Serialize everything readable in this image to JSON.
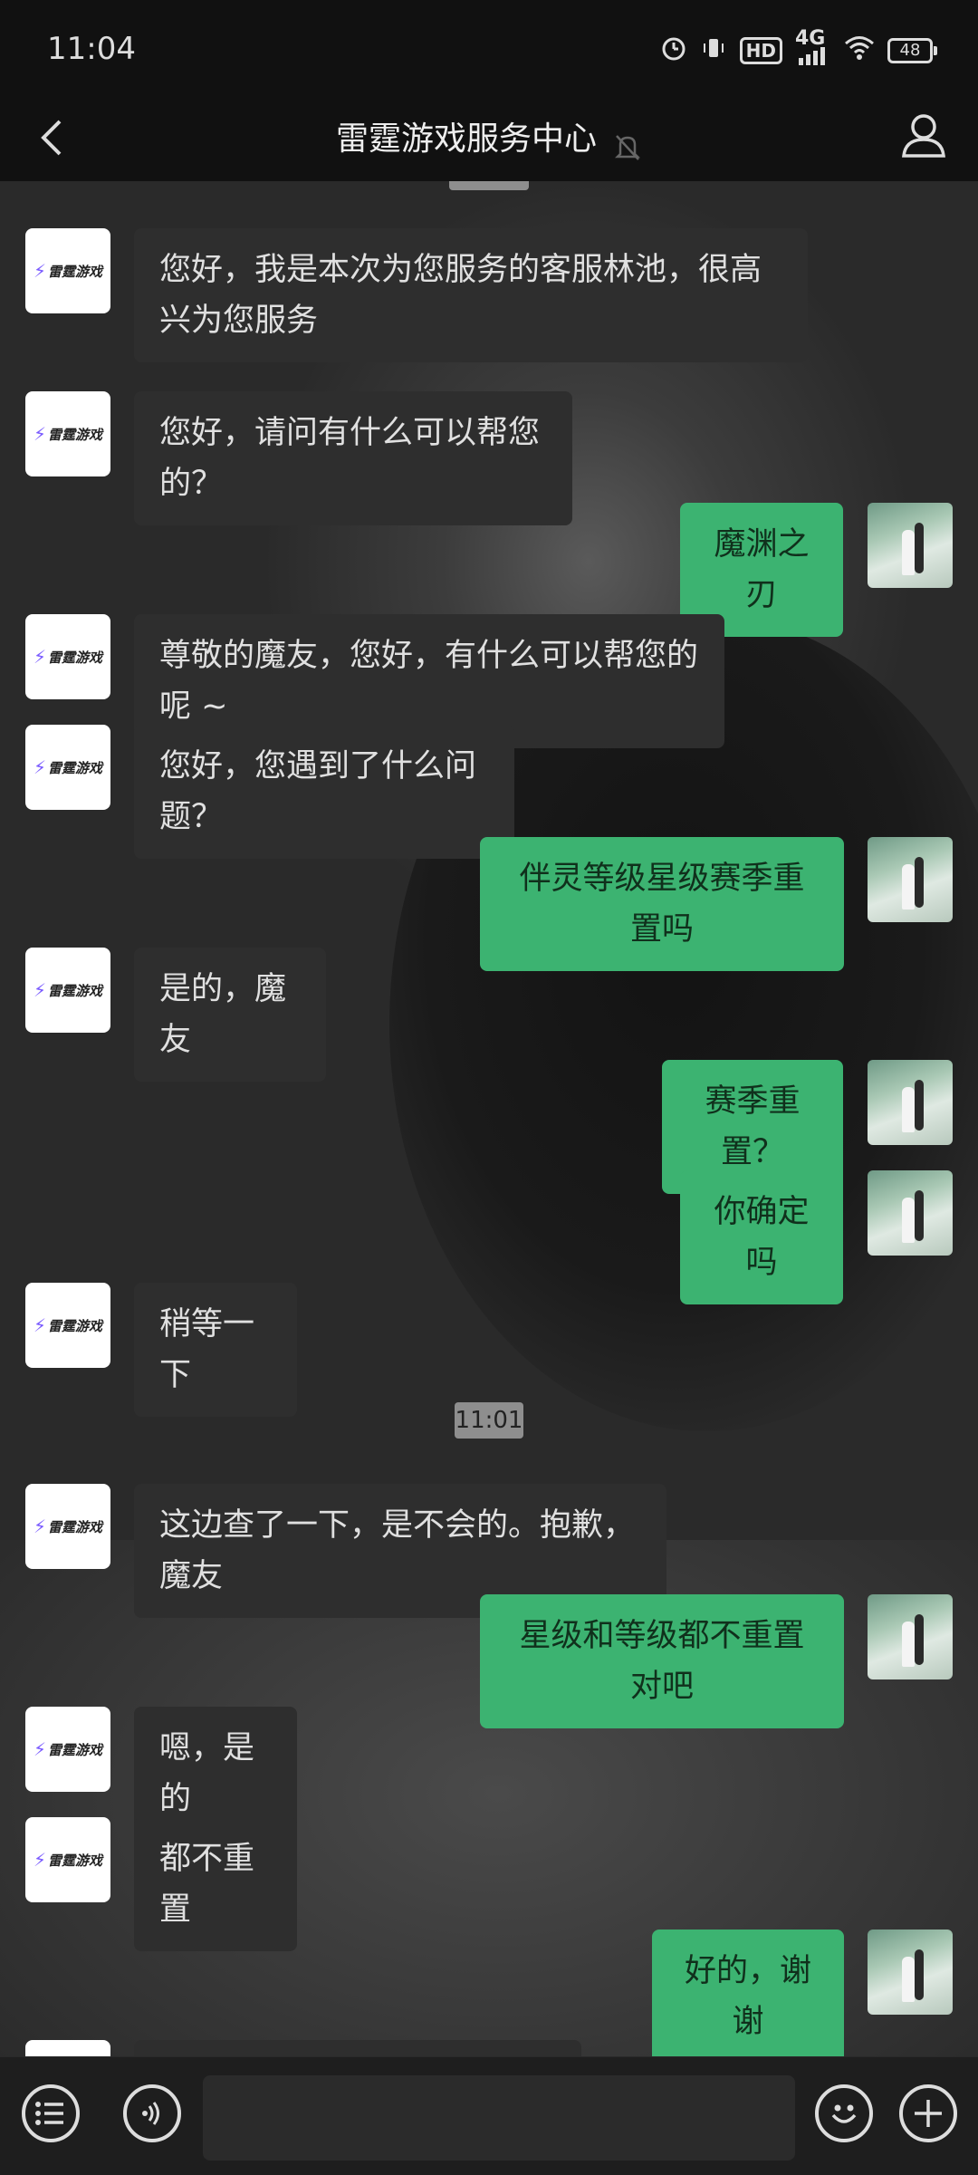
{
  "status_bar": {
    "time": "11:04",
    "network": "4G",
    "hd": "HD",
    "battery": "48"
  },
  "header": {
    "title": "雷霆游戏服务中心"
  },
  "messages": [
    {
      "side": "left",
      "text": "您好，我是本次为您服务的客服林池，很高兴为您服务"
    },
    {
      "side": "left",
      "text": "您好，请问有什么可以帮您的？"
    },
    {
      "side": "right",
      "text": "魔渊之刃"
    },
    {
      "side": "left",
      "text": "尊敬的魔友，您好，有什么可以帮您的呢 ~"
    },
    {
      "side": "left",
      "text": "您好，您遇到了什么问题？"
    },
    {
      "side": "right",
      "text": "伴灵等级星级赛季重置吗"
    },
    {
      "side": "left",
      "text": "是的，魔友"
    },
    {
      "side": "right",
      "text": "赛季重置？"
    },
    {
      "side": "right",
      "text": "你确定吗"
    },
    {
      "side": "left",
      "text": "稍等一下"
    },
    {
      "side": "left",
      "text": "这边查了一下，是不会的。抱歉，魔友"
    },
    {
      "side": "right",
      "text": "星级和等级都不重置对吧"
    },
    {
      "side": "left",
      "text": "嗯，是的"
    },
    {
      "side": "left",
      "text": "都不重置"
    },
    {
      "side": "right",
      "text": "好的，谢谢"
    }
  ],
  "timestamp": "11:01",
  "brand_logo_text": "雷霆游戏",
  "colors": {
    "right_bubble": "#3cb371",
    "left_bubble": "#2e2e2e",
    "background": "#111111"
  },
  "icons": [
    "back-icon",
    "mute-bell-icon",
    "profile-icon",
    "menu-list-icon",
    "voice-icon",
    "emoji-icon",
    "plus-icon"
  ]
}
